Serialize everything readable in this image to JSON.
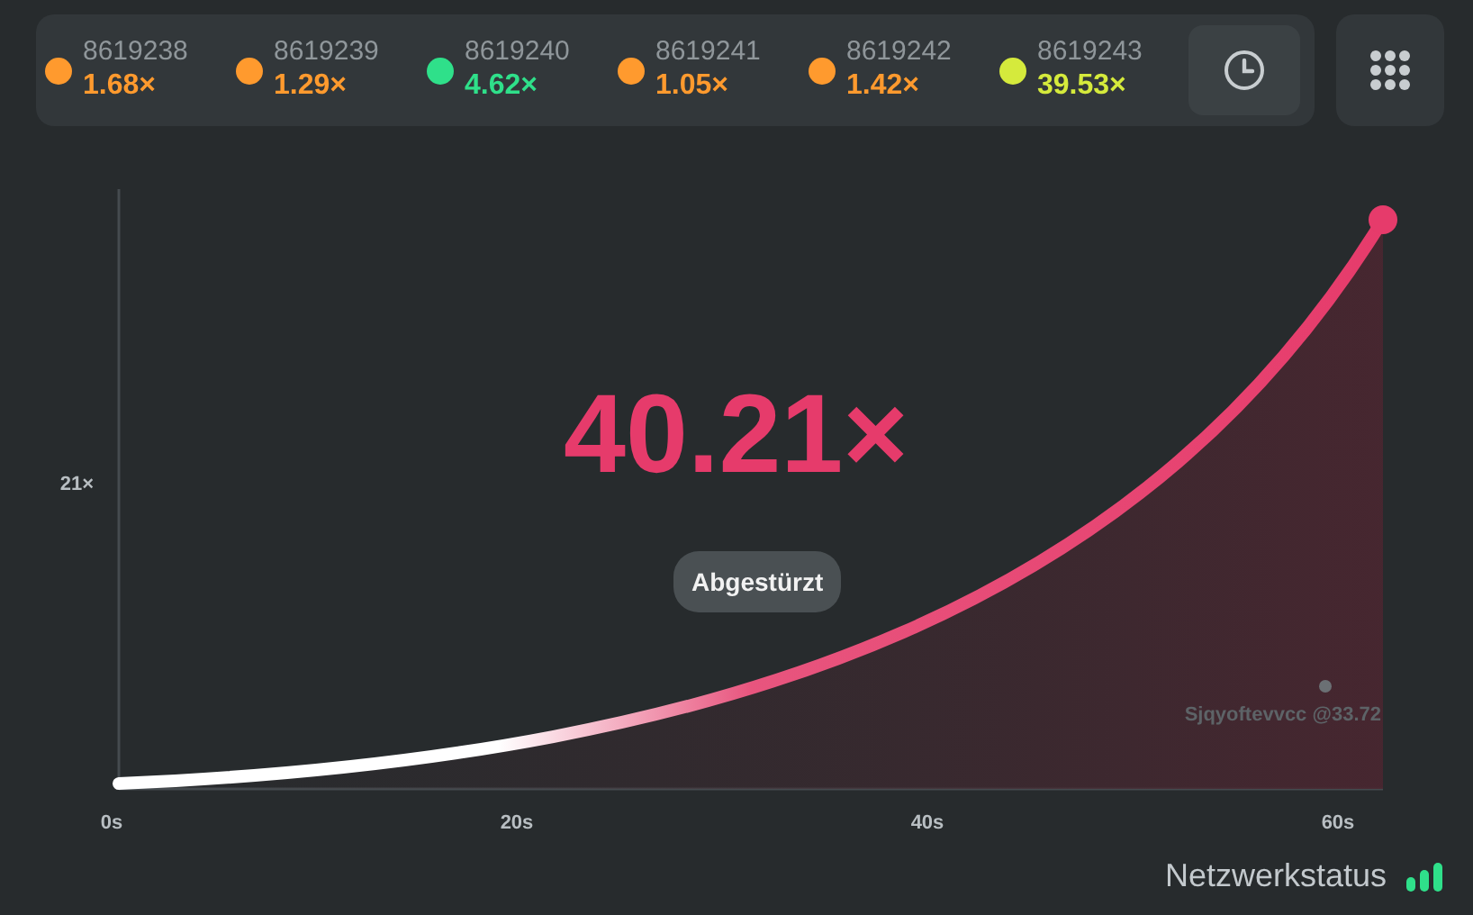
{
  "history": [
    {
      "round": "8619238",
      "multiplier": "1.68×",
      "color": "#ff9a2e"
    },
    {
      "round": "8619239",
      "multiplier": "1.29×",
      "color": "#ff9a2e"
    },
    {
      "round": "8619240",
      "multiplier": "4.62×",
      "color": "#2fe08a"
    },
    {
      "round": "8619241",
      "multiplier": "1.05×",
      "color": "#ff9a2e"
    },
    {
      "round": "8619242",
      "multiplier": "1.42×",
      "color": "#ff9a2e"
    },
    {
      "round": "8619243",
      "multiplier": "39.53×",
      "color": "#d5ea3c"
    }
  ],
  "chart": {
    "y_tick": "21×",
    "x_ticks": [
      "0s",
      "20s",
      "40s",
      "60s"
    ],
    "multiplier": "40.21×",
    "status": "Abgestürzt",
    "player": "Sjqyoftevvcc @33.72"
  },
  "network": {
    "label": "Netzwerkstatus"
  }
}
